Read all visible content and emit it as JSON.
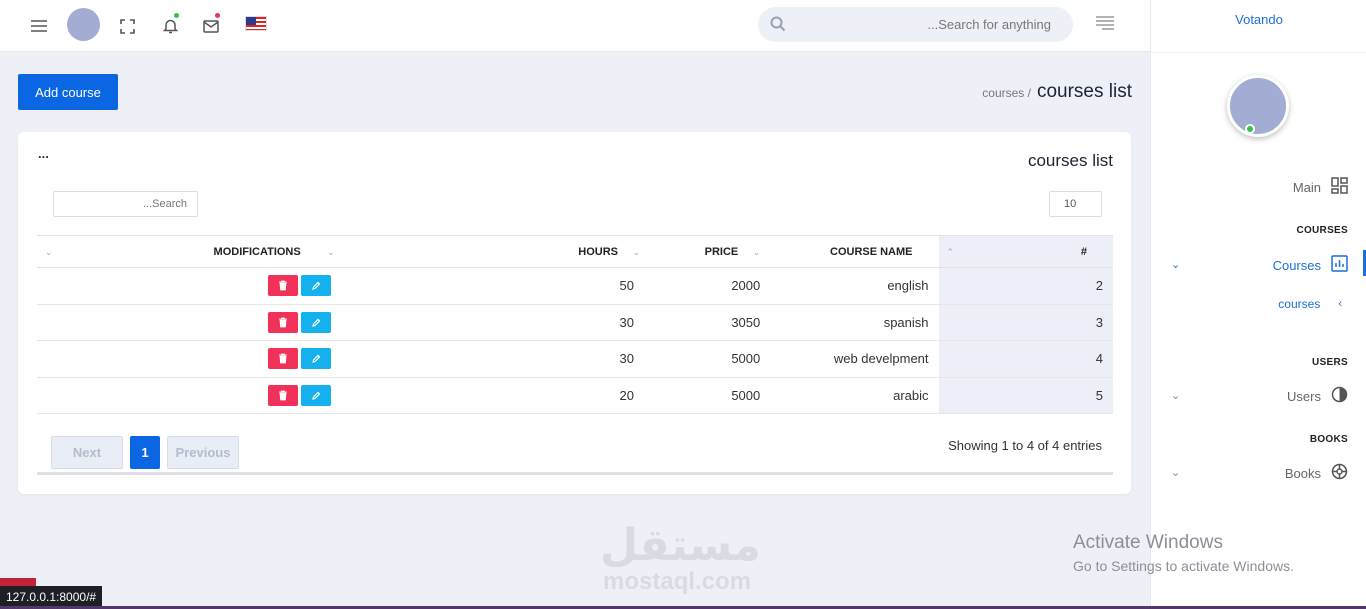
{
  "topbar": {
    "search_placeholder": "...Search for anything",
    "icons": [
      "hamburger-icon",
      "avatar",
      "fullscreen-icon",
      "bell-icon",
      "mail-icon",
      "us-flag-icon",
      "search-icon",
      "right-menu-icon"
    ],
    "bell_dot_color": "#2fbf4a",
    "mail_dot_color": "#f0325b"
  },
  "sidebar": {
    "brand": "Votando",
    "items": [
      {
        "type": "item",
        "label": "Main",
        "icon": "dashboard-grid-icon"
      },
      {
        "type": "heading",
        "label": "COURSES"
      },
      {
        "type": "item",
        "label": "Courses",
        "icon": "bar-chart-icon",
        "active": true
      },
      {
        "type": "subitem",
        "label": "courses"
      },
      {
        "type": "heading",
        "label": "USERS"
      },
      {
        "type": "item",
        "label": "Users",
        "icon": "pie-icon"
      },
      {
        "type": "heading",
        "label": "BOOKS"
      },
      {
        "type": "item",
        "label": "Books",
        "icon": "aperture-icon"
      }
    ]
  },
  "page": {
    "add_button": "Add course",
    "breadcrumb_parent": "courses /",
    "breadcrumb_current": "courses list"
  },
  "card": {
    "dots": "...",
    "title": "courses list",
    "search_placeholder": "...Search",
    "page_length": "10",
    "columns": {
      "modifications": "MODIFICATIONS",
      "hours": "HOURS",
      "price": "PRICE",
      "course_name": "COURSE NAME",
      "num": "#"
    },
    "rows": [
      {
        "hours": "50",
        "price": "2000",
        "name": "english",
        "num": "2"
      },
      {
        "hours": "30",
        "price": "3050",
        "name": "spanish",
        "num": "3"
      },
      {
        "hours": "30",
        "price": "5000",
        "name": "web develpment",
        "num": "4"
      },
      {
        "hours": "20",
        "price": "5000",
        "name": "arabic",
        "num": "5"
      }
    ],
    "pager": {
      "next": "Next",
      "current": "1",
      "previous": "Previous"
    },
    "info": "Showing 1 to 4 of 4 entries"
  },
  "overlay": {
    "watermark_ar": "مستقل",
    "watermark_en": "mostaql.com",
    "activate_title": "Activate Windows",
    "activate_sub": "Go to Settings to activate Windows.",
    "status_url": "127.0.0.1:8000/#"
  },
  "colors": {
    "primary": "#0b66e4",
    "delete": "#f0325b",
    "edit": "#15b0ee",
    "link": "#1a6fd8"
  }
}
